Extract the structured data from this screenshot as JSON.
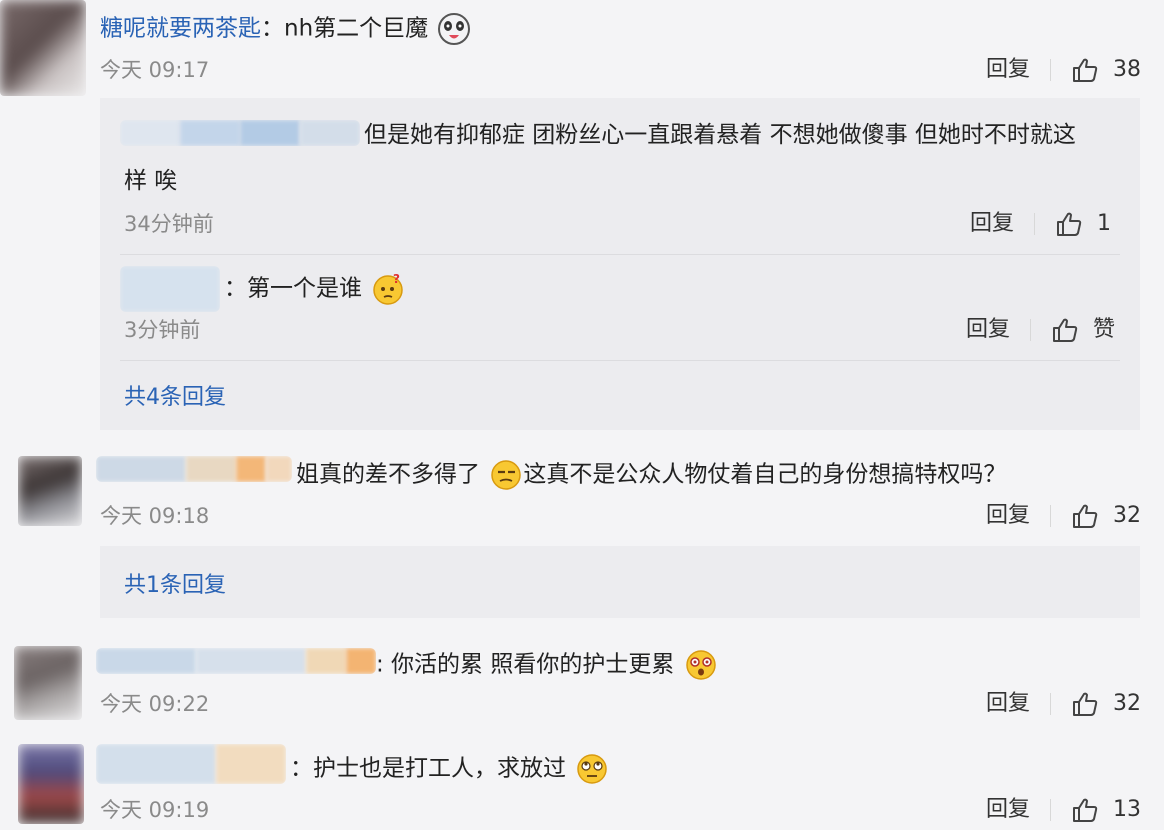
{
  "comments": [
    {
      "username": "糖呢就要两茶匙",
      "colon": "：",
      "text": "nh第二个巨魔",
      "time": "今天 09:17",
      "reply_label": "回复",
      "likes": "38",
      "replies": [
        {
          "text_line1": "但是她有抑郁症 团粉丝心一直跟着悬着 不想她做傻事 但她时不时就这",
          "text_line2": "样 唉",
          "time": "34分钟前",
          "reply_label": "回复",
          "likes": "1"
        },
        {
          "text": "：第一个是谁",
          "time": "3分钟前",
          "reply_label": "回复",
          "likes": "赞"
        }
      ],
      "more_replies": "共4条回复"
    },
    {
      "text": "姐真的差不多得了",
      "text_after": "这真不是公众人物仗着自己的身份想搞特权吗？",
      "time": "今天 09:18",
      "reply_label": "回复",
      "likes": "32",
      "more_replies": "共1条回复"
    },
    {
      "text": ": 你活的累 照看你的护士更累",
      "time": "今天 09:22",
      "reply_label": "回复",
      "likes": "32"
    },
    {
      "text": "：护士也是打工人，求放过",
      "time": "今天 09:19",
      "reply_label": "回复",
      "likes": "13"
    }
  ]
}
